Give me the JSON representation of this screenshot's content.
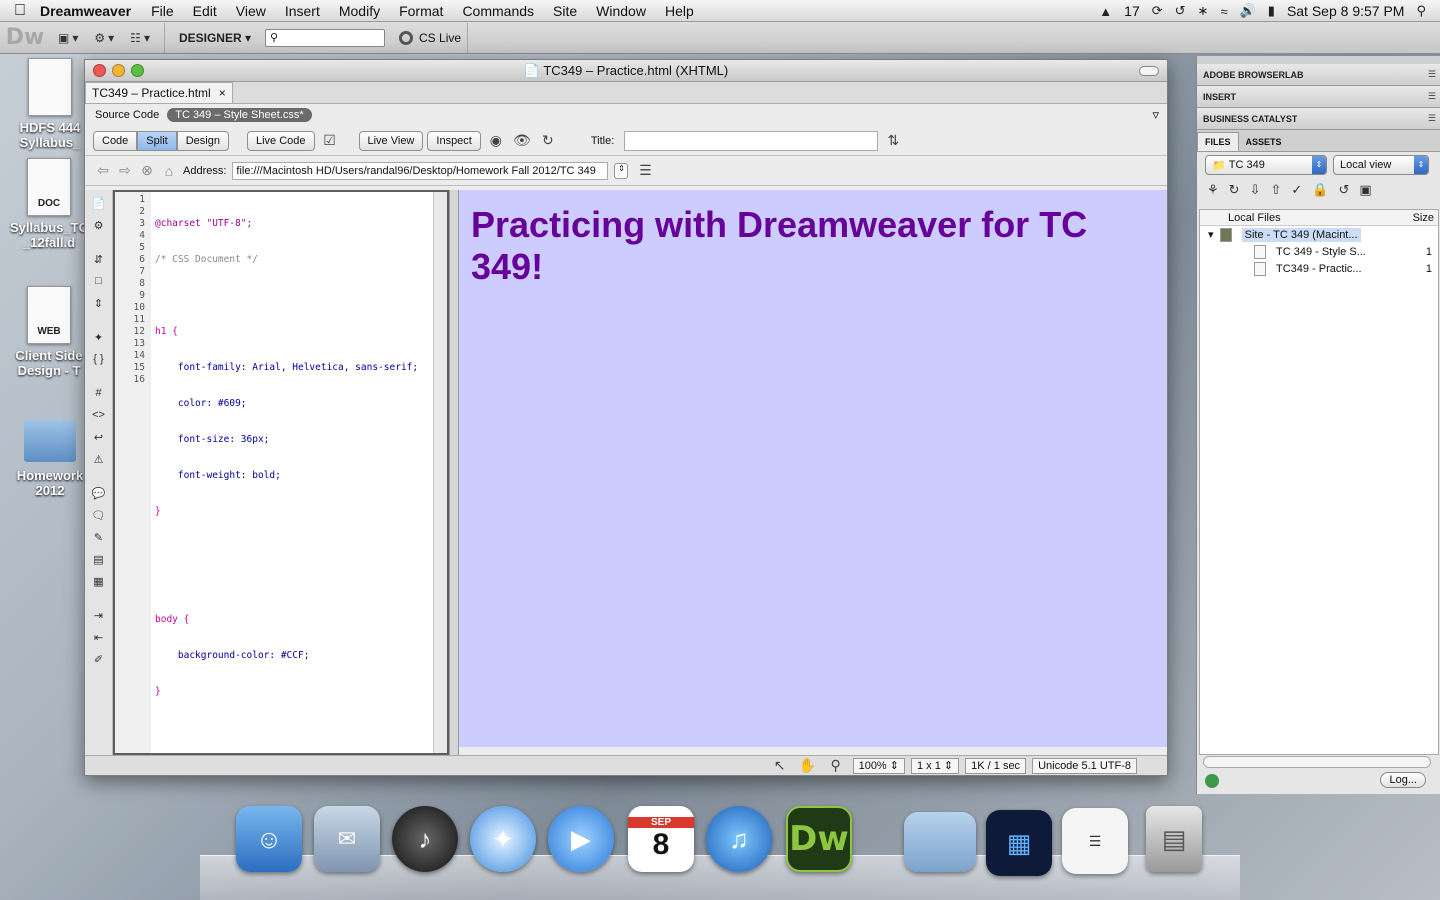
{
  "menubar": {
    "app": "Dreamweaver",
    "items": [
      "File",
      "Edit",
      "View",
      "Insert",
      "Modify",
      "Format",
      "Commands",
      "Site",
      "Window",
      "Help"
    ],
    "status_number": "17",
    "datetime": "Sat Sep 8  9:57 PM"
  },
  "apptoolbar": {
    "logo": "Dw",
    "workspace": "DESIGNER",
    "cslive": "CS Live"
  },
  "desktop": {
    "icons": [
      {
        "name": "HDFS 444 Syllabus_",
        "tag": ""
      },
      {
        "name": "Syllabus_TC _12fall.d",
        "tag": "DOC"
      },
      {
        "name": "Client Side Design - T",
        "tag": "WEB"
      },
      {
        "name": "Homework 2012",
        "tag": ""
      }
    ]
  },
  "window": {
    "title": "TC349 – Practice.html (XHTML)",
    "doc_tab": "TC349 – Practice.html",
    "source_label": "Source Code",
    "related_file": "TC 349 – Style Sheet.css*",
    "view_buttons": [
      "Code",
      "Split",
      "Design"
    ],
    "active_view": "Split",
    "live_code": "Live Code",
    "live_view": "Live View",
    "inspect": "Inspect",
    "title_label": "Title:",
    "title_value": "",
    "address_label": "Address:",
    "address": "file:///Macintosh HD/Users/randal96/Desktop/Homework Fall 2012/TC 349"
  },
  "code": {
    "line_numbers": [
      "1",
      "2",
      "3",
      "4",
      "5",
      "6",
      "7",
      "8",
      "9",
      "10",
      "11",
      "12",
      "13",
      "14",
      "15",
      "16"
    ],
    "lines": [
      "@charset \"UTF-8\";",
      "/* CSS Document */",
      "",
      "h1 {",
      "    font-family: Arial, Helvetica, sans-serif;",
      "    color: #609;",
      "    font-size: 36px;",
      "    font-weight: bold;",
      "}",
      "",
      "",
      "body {",
      "    background-color: #CCF;",
      "}",
      "",
      ""
    ]
  },
  "design": {
    "heading": "Practicing with Dreamweaver for TC 349!",
    "background": "#CCCCFF",
    "heading_color": "#660099"
  },
  "statusbar": {
    "zoom": "100%",
    "dimensions": "1 x 1",
    "size_time": "1K / 1 sec",
    "encoding": "Unicode 5.1 UTF-8"
  },
  "panels": {
    "browserlab": "ADOBE BROWSERLAB",
    "insert": "INSERT",
    "business_catalyst": "BUSINESS CATALYST",
    "tabs": [
      "FILES",
      "ASSETS"
    ],
    "site": "TC 349",
    "view": "Local view",
    "col_local": "Local Files",
    "col_size": "Size",
    "root": "Site - TC 349 (Macint...",
    "files": [
      {
        "name": "TC 349 - Style S...",
        "size": "1"
      },
      {
        "name": "TC349 - Practic...",
        "size": "1"
      }
    ],
    "log_button": "Log..."
  },
  "dock": {
    "calendar_month": "SEP",
    "calendar_day": "8",
    "dw": "Dw"
  }
}
